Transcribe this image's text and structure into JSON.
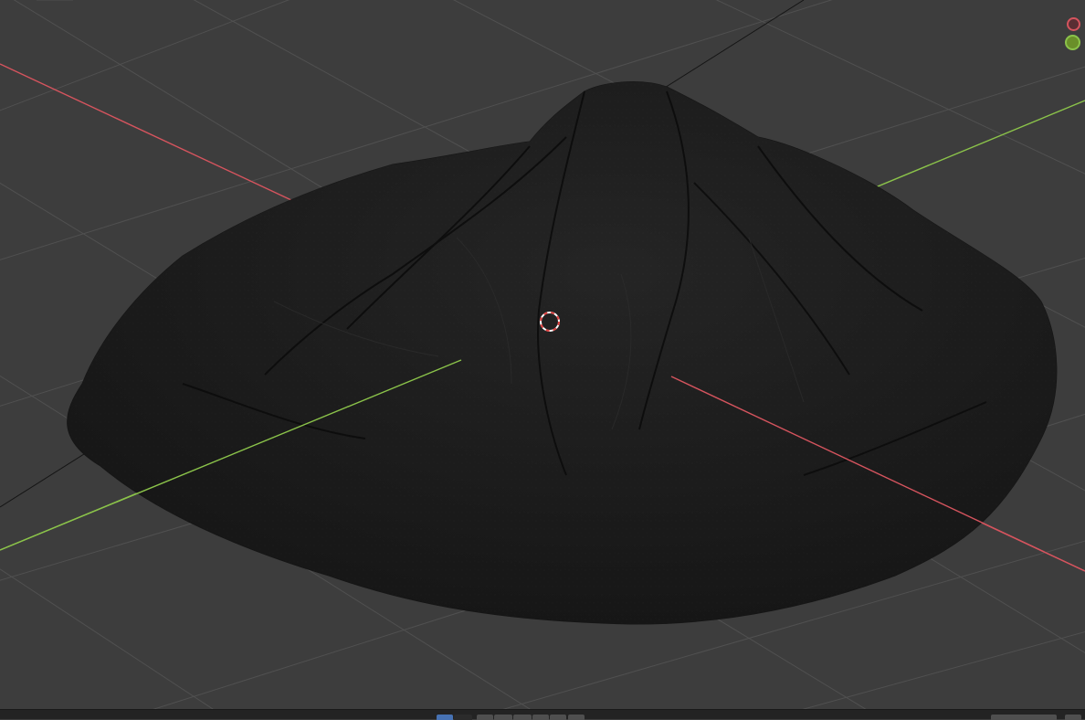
{
  "app": "3D Viewport",
  "colors": {
    "background": "#3d3d3d",
    "grid": "#535353",
    "axis_x": "#d5545e",
    "axis_y": "#8bc34a",
    "mesh": "#1b1b1b",
    "cursor_red": "#e04040",
    "status_bar": "#232323",
    "active_button": "#4772b3"
  },
  "gizmo": {
    "items": [
      {
        "name": "x-axis-gizmo",
        "color": "#d5545e"
      },
      {
        "name": "y-axis-gizmo",
        "color": "#8bc34a"
      }
    ]
  },
  "scene": {
    "object": "terrain-mesh",
    "cursor": "3d-cursor-icon"
  },
  "statusbar": {
    "buttons": [
      "active-mode",
      "mode-2",
      "mode-3",
      "mode-4",
      "mode-5",
      "mode-6",
      "mode-7",
      "mode-8"
    ]
  }
}
